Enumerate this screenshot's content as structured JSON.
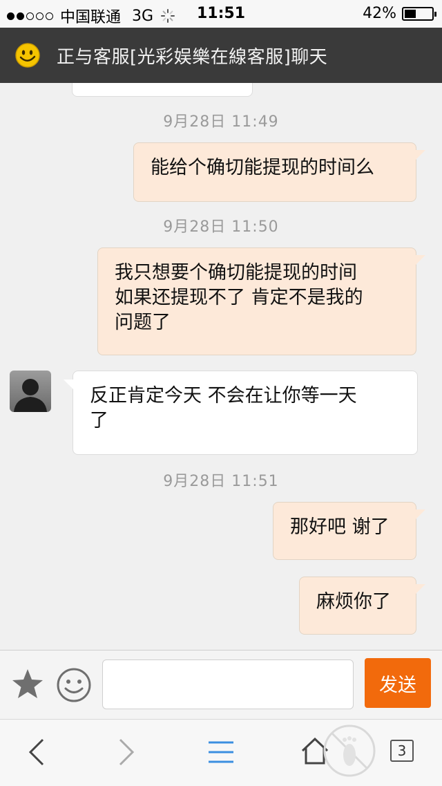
{
  "status_bar": {
    "carrier": "中国联通",
    "network": "3G",
    "time": "11:51",
    "battery_percent": "42%",
    "battery_level": 0.42,
    "signal_dots_filled": 2,
    "signal_dots_total": 5
  },
  "header": {
    "title": "正与客服[光彩娱樂在線客服]聊天",
    "icon": "smiley-icon"
  },
  "messages": [
    {
      "type": "timestamp",
      "text": "9月28日 11:49"
    },
    {
      "type": "outgoing",
      "text": "能给个确切能提现的时间么"
    },
    {
      "type": "timestamp",
      "text": "9月28日 11:50"
    },
    {
      "type": "outgoing",
      "lines": [
        "我只想要个确切能提现的时间",
        "如果还提现不了 肯定不是我的",
        "问题了"
      ]
    },
    {
      "type": "incoming",
      "lines": [
        "反正肯定今天 不会在让你等一天",
        "了"
      ]
    },
    {
      "type": "timestamp",
      "text": "9月28日 11:51"
    },
    {
      "type": "outgoing",
      "text": "那好吧 谢了"
    },
    {
      "type": "outgoing",
      "text": "麻烦你了"
    }
  ],
  "input": {
    "value": "",
    "send_label": "发送"
  },
  "toolbar": {
    "tab_count": "3"
  },
  "colors": {
    "header_bg": "#3a3a3a",
    "outgoing_bubble": "#fde9d9",
    "incoming_bubble": "#ffffff",
    "send_button": "#f26a0c"
  }
}
